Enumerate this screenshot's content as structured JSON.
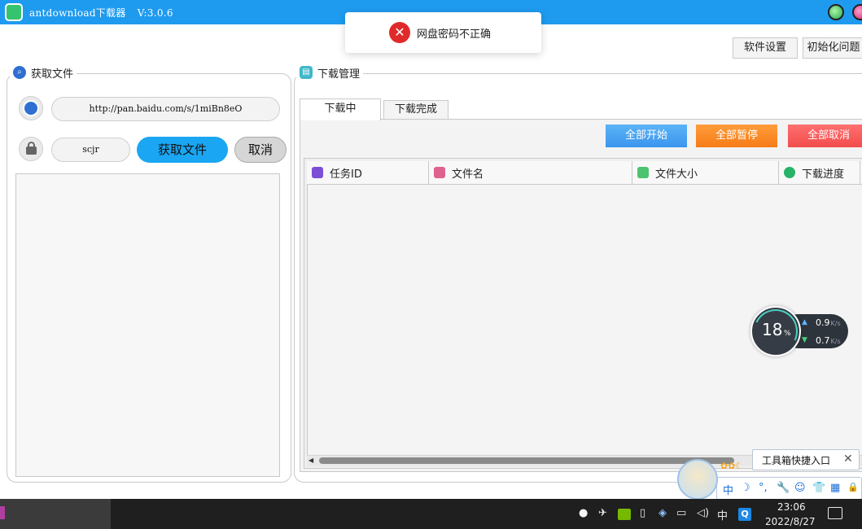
{
  "window": {
    "app_name": "antdownload下载器",
    "version": "V:3.0.6"
  },
  "toast": {
    "message": "网盘密码不正确",
    "icon": "error-x-icon",
    "color": "#e02a2a"
  },
  "toolbar": {
    "settings_label": "软件设置",
    "init_label": "初始化问题"
  },
  "fetch_panel": {
    "title": "获取文件",
    "url_value": "http://pan.baidu.com/s/1miBn8eO",
    "password_value": "scjr",
    "fetch_button": "获取文件",
    "cancel_button": "取消"
  },
  "download_panel": {
    "title": "下载管理",
    "tabs": [
      {
        "label": "下载中",
        "active": true
      },
      {
        "label": "下载完成",
        "active": false
      }
    ],
    "actions": {
      "start_all": "全部开始",
      "pause_all": "全部暂停",
      "cancel_all": "全部取消"
    },
    "columns": [
      "任务ID",
      "文件名",
      "文件大小",
      "下载进度"
    ],
    "rows": []
  },
  "speed_widget": {
    "percent": "18",
    "percent_sign": "%",
    "up_value": "0.9",
    "down_value": "0.7",
    "unit": "K/s"
  },
  "ime": {
    "tooltip": "工具箱快捷入口",
    "close": "✕",
    "mode": "中",
    "items": [
      "☽",
      "°,",
      "🔧",
      "☺",
      "👕",
      "▦",
      "🔒"
    ]
  },
  "taskbar": {
    "tray_ime": "中",
    "tray_q": "Q",
    "time": "23:06",
    "date": "2022/8/27"
  },
  "colors": {
    "titlebar": "#1e9bef",
    "start_all": "#4aa4f3",
    "pause_all": "#f78a22",
    "cancel_all": "#f45d5d",
    "fetch_button": "#1aa6f2"
  }
}
